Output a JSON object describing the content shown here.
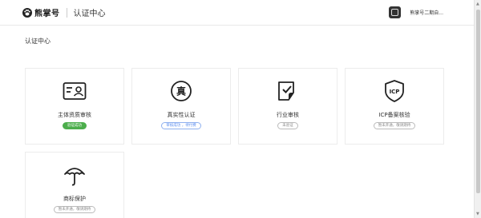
{
  "header": {
    "logo_text": "熊掌号",
    "page_name": "认证中心",
    "user_name": "熊掌号二期自..."
  },
  "section_title": "认证中心",
  "cards": [
    {
      "title": "主体资质审核",
      "status": "验证成功",
      "status_kind": "success",
      "icon": "id-card-icon"
    },
    {
      "title": "真实性认证",
      "status": "审核成功 ，待付费",
      "status_kind": "info",
      "icon": "seal-zhen-icon"
    },
    {
      "title": "行业审核",
      "status": "未验证",
      "status_kind": "neutral",
      "icon": "checkbox-document-icon"
    },
    {
      "title": "ICP备案核验",
      "status": "暂未开通，敬请期待",
      "status_kind": "neutral",
      "icon": "icp-shield-icon"
    },
    {
      "title": "商标保护",
      "status": "暂未开通，敬请期待",
      "status_kind": "neutral",
      "icon": "umbrella-icon"
    }
  ],
  "colors": {
    "success": "#4cae4c",
    "info": "#5b8def",
    "neutral": "#888888"
  }
}
